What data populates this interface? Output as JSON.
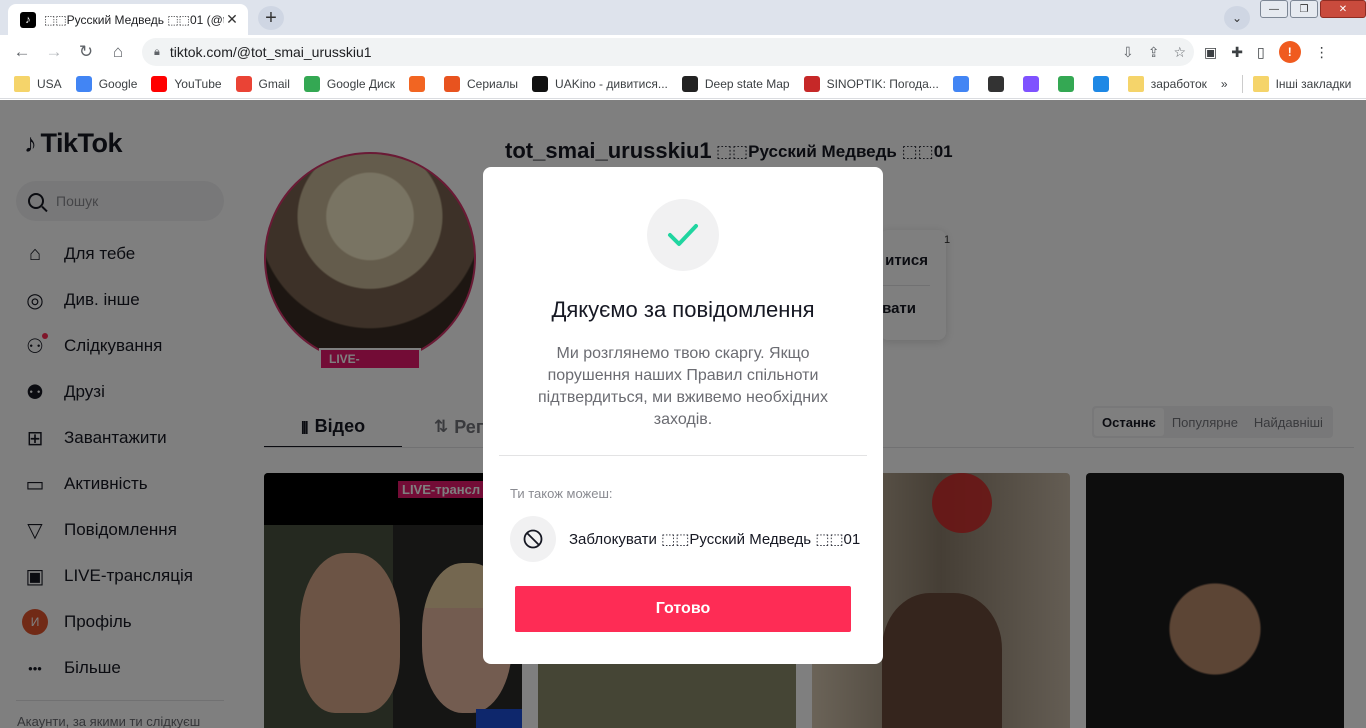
{
  "browser": {
    "tab_title": "⬚⬚Русский Медведь ⬚⬚01 (@to",
    "tab_close": "✕",
    "new_tab": "+",
    "url": "tiktok.com/@tot_smai_urusskiu1",
    "profile_initial": "!",
    "bookmarks": [
      {
        "label": "USA",
        "icon": "folder-icon",
        "color": "#f5d46a"
      },
      {
        "label": "Google",
        "icon": "google-icon",
        "color": "#4285f4"
      },
      {
        "label": "YouTube",
        "icon": "youtube-icon",
        "color": "#ff0000"
      },
      {
        "label": "Gmail",
        "icon": "gmail-icon",
        "color": "#ea4335"
      },
      {
        "label": "Google Диск",
        "icon": "google-drive-icon",
        "color": "#34a853"
      },
      {
        "label": "",
        "icon": "f-app-icon",
        "color": "#f26522"
      },
      {
        "label": "Сериалы",
        "icon": "fox-icon",
        "color": "#e8531f"
      },
      {
        "label": "UAKino - дивитися...",
        "icon": "uakino-icon",
        "color": "#111111"
      },
      {
        "label": "Deep state Map",
        "icon": "deepstate-icon",
        "color": "#222222"
      },
      {
        "label": "SINOPTIK: Погода...",
        "icon": "thermometer-icon",
        "color": "#c62828"
      },
      {
        "label": "",
        "icon": "translate-icon",
        "color": "#4285f4"
      },
      {
        "label": "",
        "icon": "bc-icon",
        "color": "#333333"
      },
      {
        "label": "",
        "icon": "kotlin-icon",
        "color": "#7f52ff"
      },
      {
        "label": "",
        "icon": "maps-icon",
        "color": "#34a853"
      },
      {
        "label": "",
        "icon": "star-burst-icon",
        "color": "#1e88e5"
      },
      {
        "label": "заработок",
        "icon": "folder-icon",
        "color": "#f5d46a"
      }
    ],
    "bookmarks_more": "»",
    "other_bookmarks": "Інші закладки"
  },
  "sidebar": {
    "logo": "TikTok",
    "search_placeholder": "Пошук",
    "nav": [
      {
        "label": "Для тебе",
        "icon": "home-icon"
      },
      {
        "label": "Див. інше",
        "icon": "compass-icon"
      },
      {
        "label": "Слідкування",
        "icon": "following-icon"
      },
      {
        "label": "Друзі",
        "icon": "friends-icon"
      },
      {
        "label": "Завантажити",
        "icon": "upload-icon"
      },
      {
        "label": "Активність",
        "icon": "activity-icon"
      },
      {
        "label": "Повідомлення",
        "icon": "messages-icon"
      },
      {
        "label": "LIVE-трансляція",
        "icon": "live-icon"
      },
      {
        "label": "Профіль",
        "icon": "profile-avatar",
        "avatar_initial": "И"
      },
      {
        "label": "Більше",
        "icon": "more-icon"
      }
    ],
    "footer": "Акаунти, за якими ти слідкуєш"
  },
  "profile": {
    "username": "tot_smai_urusskiu1",
    "nickname": "⬚⬚Русский Медведь ⬚⬚01",
    "live_badge": "LIVE-",
    "follow_label_partial": "итися",
    "action_label_partial": "вати",
    "edge_digit": "1",
    "tabs": {
      "videos": "Відео",
      "reposts": "Репости"
    },
    "sort": {
      "latest": "Останнє",
      "popular": "Популярне",
      "oldest": "Найдавніші"
    },
    "thumb_live_tag": "LIVE-трансл"
  },
  "modal": {
    "title": "Дякуємо за повідомлення",
    "body": "Ми розглянемо твою скаргу. Якщо порушення наших Правил спільноти підтвердиться, ми вживемо необхідних заходів.",
    "also_label": "Ти також можеш:",
    "block_label": "Заблокувати ⬚⬚Русский Медведь ⬚⬚01",
    "done_button": "Готово",
    "check_color": "#20d5a0"
  },
  "colors": {
    "brand": "#fe2c55",
    "live": "#e6186c"
  }
}
